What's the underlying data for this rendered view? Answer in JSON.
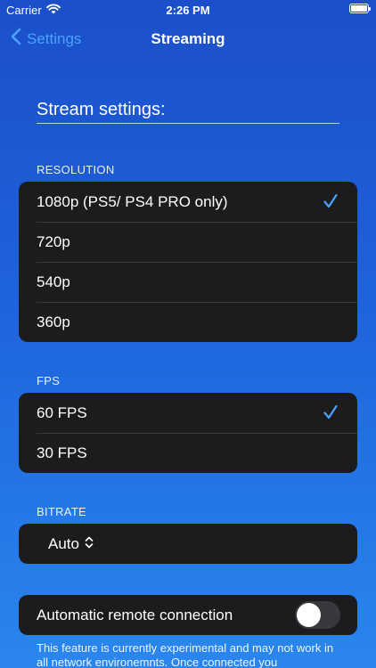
{
  "status_bar": {
    "carrier": "Carrier",
    "time": "2:26 PM"
  },
  "nav": {
    "back_label": "Settings",
    "title": "Streaming"
  },
  "stream_field": {
    "value": "Stream settings:"
  },
  "resolution": {
    "header": "RESOLUTION",
    "options": [
      "1080p (PS5/ PS4 PRO only)",
      "720p",
      "540p",
      "360p"
    ],
    "selected_index": 0
  },
  "fps": {
    "header": "FPS",
    "options": [
      "60 FPS",
      "30 FPS"
    ],
    "selected_index": 0
  },
  "bitrate": {
    "header": "BITRATE",
    "value": "Auto"
  },
  "remote": {
    "label": "Automatic remote connection",
    "enabled": false,
    "footnote": "This feature is currently experimental and may not work in all network environemnts. Once connected you"
  },
  "colors": {
    "accent": "#4aa3ff",
    "cell_bg": "#1c1c1e",
    "toggle_off": "#39393d"
  },
  "icons": {
    "back": "chevron-left-icon",
    "check": "checkmark-icon",
    "updown": "chevron-up-down-icon"
  }
}
